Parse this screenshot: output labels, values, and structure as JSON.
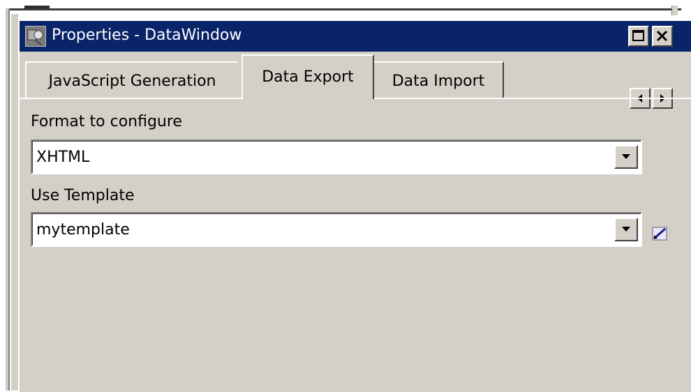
{
  "window": {
    "title": "Properties -  DataWindow",
    "app_icon": "properties-icon",
    "maximize_icon": "maximize-icon",
    "close_icon": "close-icon"
  },
  "tabs": [
    {
      "label": "JavaScript Generation",
      "selected": false
    },
    {
      "label": "Data Export",
      "selected": true
    },
    {
      "label": "Data Import",
      "selected": false
    }
  ],
  "tab_scroll": {
    "left_icon": "arrow-left-icon",
    "right_icon": "arrow-right-icon"
  },
  "form": {
    "format_label": "Format to configure",
    "format_value": "XHTML",
    "template_label": "Use Template",
    "template_value": "mytemplate",
    "edit_template_icon": "edit-icon"
  },
  "colors": {
    "titlebar": "#0a246a",
    "face": "#d4d0c8"
  }
}
